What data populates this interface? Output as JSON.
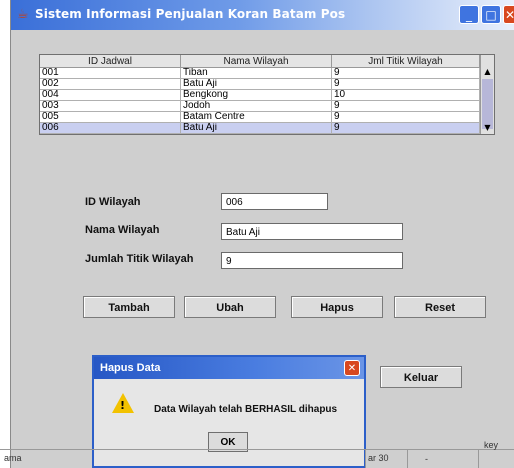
{
  "window": {
    "title": "Sistem Informasi Penjualan Koran Batam Pos",
    "min_glyph": "_",
    "max_glyph": "□",
    "close_glyph": "✕"
  },
  "table": {
    "columns": [
      "ID Jadwal",
      "Nama Wilayah",
      "Jml Titik Wilayah"
    ],
    "rows": [
      [
        "001",
        "Tiban",
        "9"
      ],
      [
        "002",
        "Batu Aji",
        "9"
      ],
      [
        "004",
        "Bengkong",
        "10"
      ],
      [
        "003",
        "Jodoh",
        "9"
      ],
      [
        "005",
        "Batam Centre",
        "9"
      ],
      [
        "006",
        "Batu Aji",
        "9"
      ]
    ],
    "selected_row": 5
  },
  "form": {
    "id_label": "ID Wilayah",
    "id_value": "006",
    "nama_label": "Nama Wilayah",
    "nama_value": "Batu Aji",
    "jumlah_label": "Jumlah Titik Wilayah",
    "jumlah_value": "9"
  },
  "buttons": {
    "tambah": "Tambah",
    "ubah": "Ubah",
    "hapus": "Hapus",
    "reset": "Reset",
    "keluar": "Keluar"
  },
  "dialog": {
    "title": "Hapus Data",
    "message": "Data Wilayah telah BERHASIL dihapus",
    "ok": "OK",
    "close_glyph": "✕"
  },
  "background_fragments": {
    "left": "ama",
    "middle": "ar 30",
    "dash": "-",
    "right": "key"
  }
}
